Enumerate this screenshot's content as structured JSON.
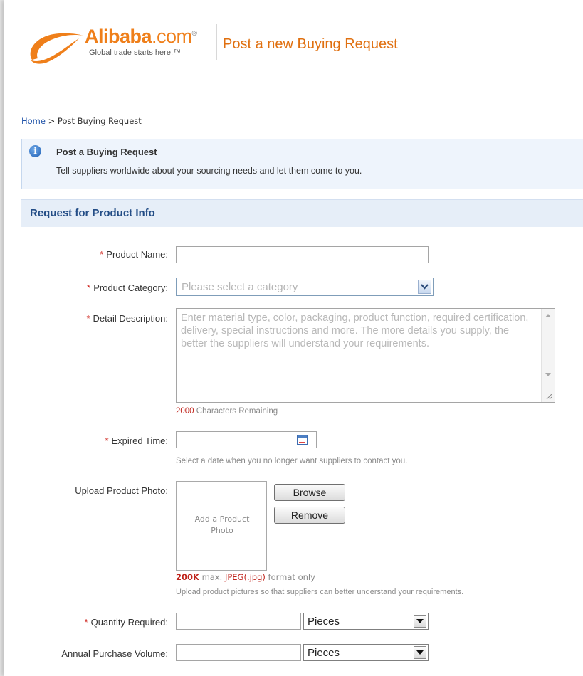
{
  "header": {
    "logo_brand": "Alibaba",
    "logo_domain": ".com",
    "logo_reg": "®",
    "logo_tagline": "Global trade starts here.™",
    "page_title": "Post a new Buying Request"
  },
  "breadcrumb": {
    "home": "Home",
    "separator": ">",
    "current": "Post Buying Request"
  },
  "info_box": {
    "title": "Post a Buying Request",
    "text": "Tell suppliers worldwide about your sourcing needs and let them come to you."
  },
  "section": {
    "title": "Request for Product Info"
  },
  "form": {
    "required_marker": "*",
    "product_name": {
      "label": "Product Name:",
      "value": ""
    },
    "product_category": {
      "label": "Product Category:",
      "placeholder": "Please select a category"
    },
    "detail_description": {
      "label": "Detail Description:",
      "placeholder": "Enter material type, color, packaging, product function, required certification, delivery, special instructions and more. The more details you supply, the better the suppliers will understand your requirements.",
      "chars_count": "2000",
      "chars_text": "Characters Remaining"
    },
    "expired_time": {
      "label": "Expired Time:",
      "value": "",
      "hint": "Select a date when you no longer want suppliers to contact you."
    },
    "upload_photo": {
      "label": "Upload Product Photo:",
      "box_text": "Add a Product Photo",
      "browse_label": "Browse",
      "remove_label": "Remove",
      "size_limit": "200K",
      "max_text": "max.",
      "format": "JPEG(.jpg)",
      "format_only": "format only",
      "hint": "Upload product pictures so that suppliers can better understand your requirements."
    },
    "quantity_required": {
      "label": "Quantity Required:",
      "value": "",
      "unit": "Pieces"
    },
    "annual_purchase_volume": {
      "label": "Annual Purchase Volume:",
      "value": "",
      "unit": "Pieces"
    }
  },
  "colors": {
    "brand_orange": "#ef7f1a",
    "heading_orange": "#e07010",
    "section_blue": "#234d86",
    "required_red": "#d0261f"
  }
}
